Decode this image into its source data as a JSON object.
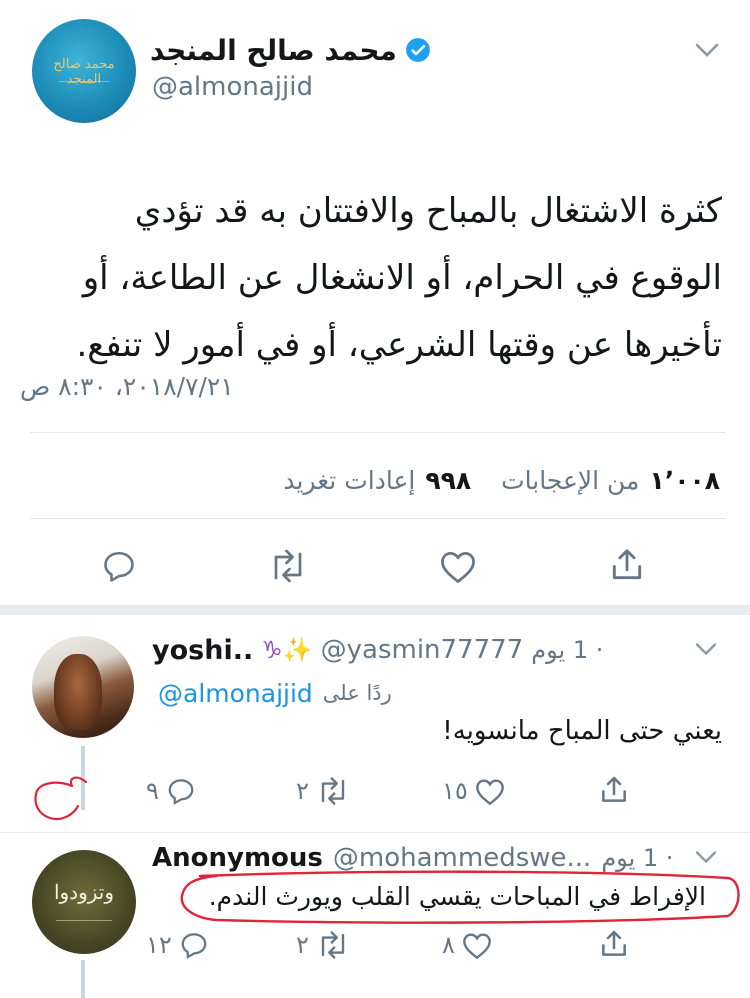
{
  "main_tweet": {
    "author_name": "محمد صالح المنجد",
    "author_handle": "@almonajjid",
    "avatar_calligraphy": "محمد صالح المنجد",
    "text_lines": [
      "كثرة الاشتغال بالمباح والافتتان به قد تؤدي",
      "الوقوع في الحرام، أو الانشغال عن الطاعة، أو",
      "تأخيرها عن وقتها الشرعي، أو في أمور لا تنفع."
    ],
    "timestamp": "٢٠١٨/٧/٢١، ٨:٣٠ ص",
    "likes_count": "١٬٠٠٨",
    "likes_label": "من الإعجابات",
    "retweets_count": "٩٩٨",
    "retweets_label": "إعادات تغريد"
  },
  "replies": [
    {
      "name": "yoshi..",
      "emoji": "♑✨",
      "handle": "@yasmin77777",
      "time": "· 1 يوم",
      "reply_to_label": "ردًا على",
      "reply_to_handle": "@almonajjid",
      "text": "يعني حتى المباح مانسويه!",
      "reply_count": "٩",
      "retweet_count": "٢",
      "like_count": "١٥"
    },
    {
      "name": "Anonymous",
      "handle": "@mohammedswe...",
      "time": "· 1 يوم",
      "avatar_text": "وتزودوا",
      "text": "الإفراط في المباحات يقسي القلب ويورث الندم.",
      "reply_count": "١٢",
      "retweet_count": "٢",
      "like_count": "٨"
    }
  ],
  "colors": {
    "accent": "#1da1f2",
    "link": "#1b95e0",
    "muted": "#657786",
    "annotation": "#e0253a"
  }
}
